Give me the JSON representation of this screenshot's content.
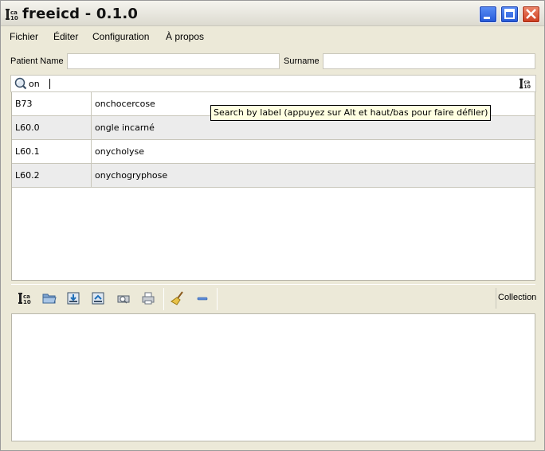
{
  "window": {
    "title": "freeicd - 0.1.0",
    "app_icon": "icd-logo-icon",
    "controls": [
      "minimize-icon",
      "maximize-icon",
      "close-icon"
    ]
  },
  "menu": {
    "items": [
      {
        "label": "Fichier"
      },
      {
        "label": "Éditer"
      },
      {
        "label": "Configuration"
      },
      {
        "label": "À propos"
      }
    ]
  },
  "patient": {
    "name_label": "Patient Name",
    "name_value": "",
    "surname_label": "Surname",
    "surname_value": ""
  },
  "search": {
    "value": "on",
    "icon": "search-icon",
    "tooltip": "Search by label (appuyez sur Alt et haut/bas pour faire défiler)"
  },
  "results": [
    {
      "code": "B73",
      "label": "onchocercose"
    },
    {
      "code": "L60.0",
      "label": "ongle incarné"
    },
    {
      "code": "L60.1",
      "label": "onycholyse"
    },
    {
      "code": "L60.2",
      "label": "onychogryphose"
    }
  ],
  "toolbar": {
    "buttons": [
      "icd-logo-icon",
      "open-folder-icon",
      "import-icon",
      "export-icon",
      "print-preview-icon",
      "print-icon",
      "broom-icon",
      "remove-icon"
    ],
    "collection_label": "Collection"
  },
  "colors": {
    "window_bg": "#ece9d8",
    "tooltip_bg": "#ffffe1",
    "alt_row_bg": "#ececec",
    "titlebar_btn_blue": "#2458d8",
    "titlebar_btn_red": "#cc3b1e"
  }
}
